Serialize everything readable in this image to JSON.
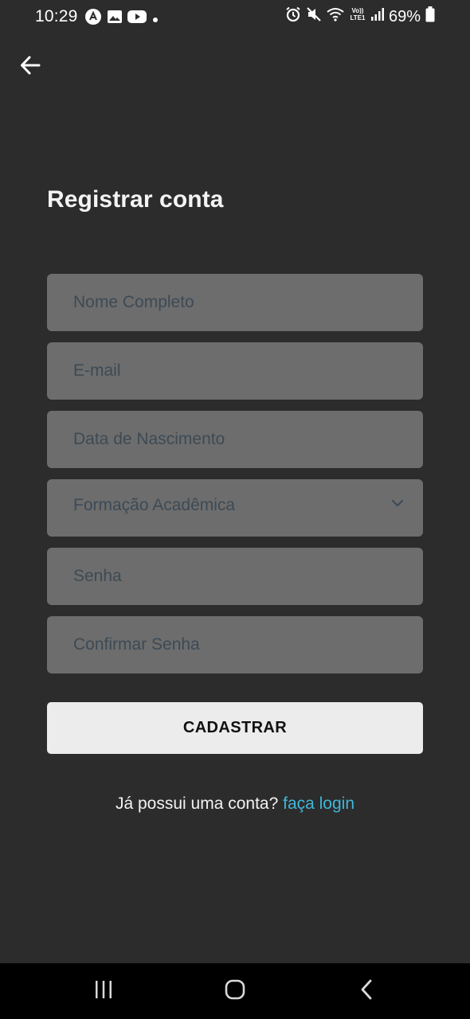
{
  "status_bar": {
    "time": "10:29",
    "battery": "69%",
    "left_icons": [
      "notification-a-icon",
      "gallery-icon",
      "youtube-icon",
      "dot-icon"
    ],
    "right_icons": [
      "alarm-icon",
      "mute-icon",
      "wifi-icon",
      "volte-icon",
      "signal-icon",
      "battery-icon"
    ]
  },
  "header": {
    "back_icon": "arrow-left-icon"
  },
  "title": "Registrar conta",
  "form": {
    "full_name_placeholder": "Nome Completo",
    "email_placeholder": "E-mail",
    "birthdate_placeholder": "Data de Nascimento",
    "education_placeholder": "Formação Acadêmica",
    "password_placeholder": "Senha",
    "confirm_password_placeholder": "Confirmar Senha",
    "submit_label": "CADASTRAR"
  },
  "footer": {
    "prompt": "Já possui uma conta? ",
    "login_link": "faça login"
  },
  "colors": {
    "background": "#2c2c2c",
    "field": "#6d6d6d",
    "placeholder": "#3d4a55",
    "button": "#ececec",
    "link": "#3fb7d9"
  }
}
